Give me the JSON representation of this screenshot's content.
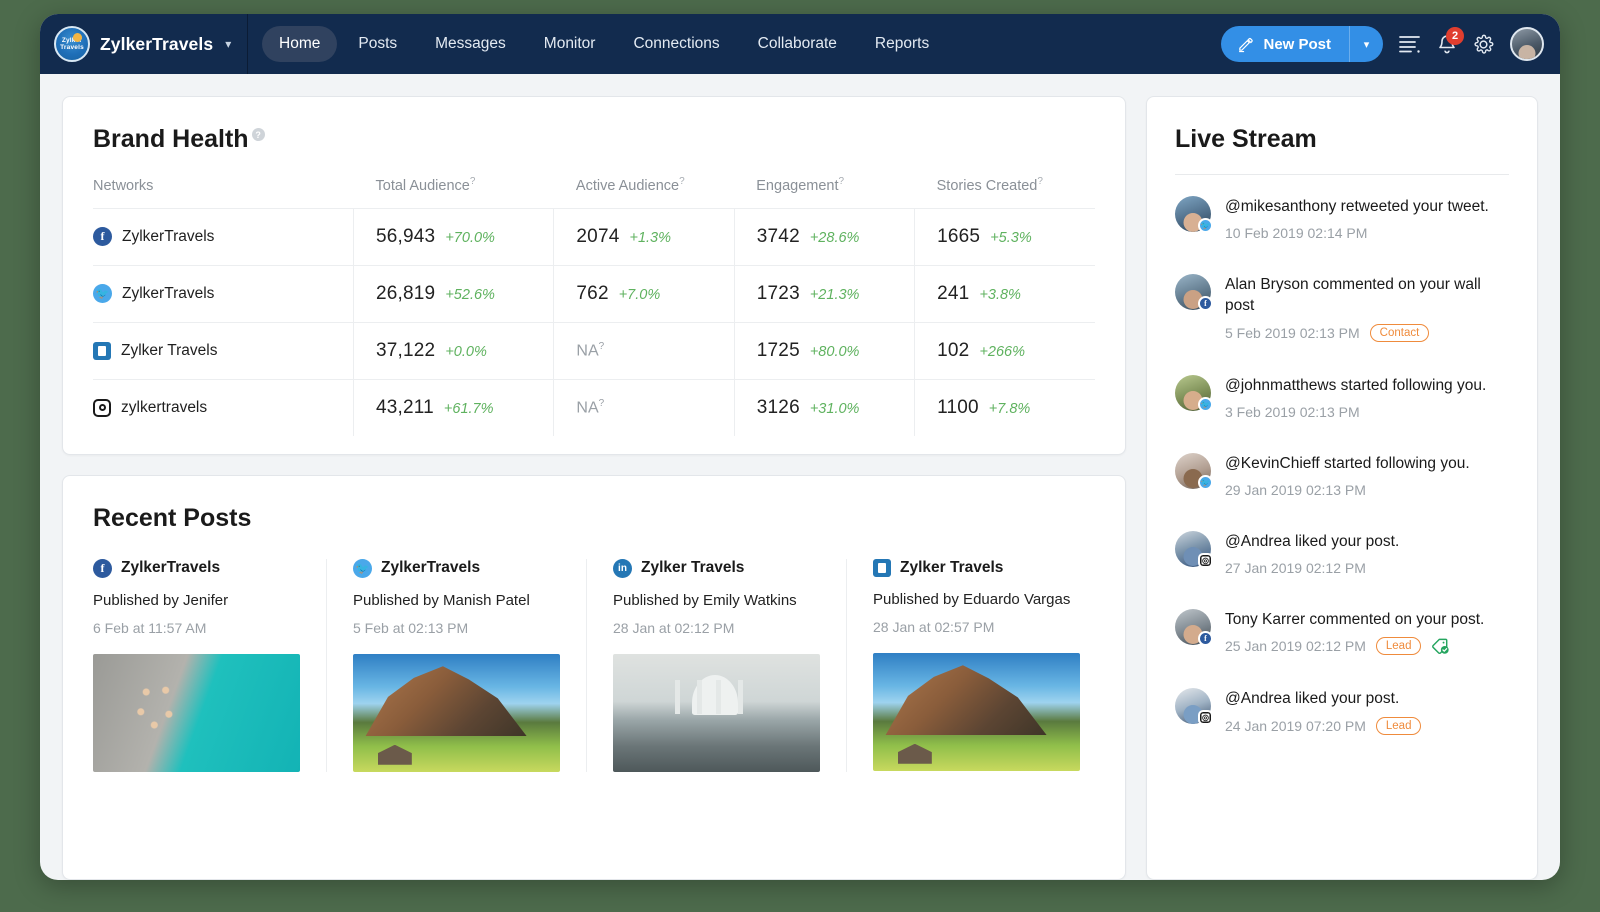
{
  "navbar": {
    "brand_logo_line1": "Zylker",
    "brand_logo_line2": "Travels",
    "brand_name": "ZylkerTravels",
    "brand_caret": "❯",
    "links": [
      {
        "label": "Home",
        "active": true
      },
      {
        "label": "Posts",
        "active": false
      },
      {
        "label": "Messages",
        "active": false
      },
      {
        "label": "Monitor",
        "active": false
      },
      {
        "label": "Connections",
        "active": false
      },
      {
        "label": "Collaborate",
        "active": false
      },
      {
        "label": "Reports",
        "active": false
      }
    ],
    "new_post_label": "New Post",
    "new_post_caret": "❯",
    "notification_count": "2",
    "accent_color": "#338fe6",
    "navbar_color": "#122b4e",
    "badge_color": "#e03e2f"
  },
  "brand_health": {
    "title": "Brand Health",
    "help_glyph": "?",
    "columns": [
      {
        "label": "Networks",
        "has_help": false
      },
      {
        "label": "Total Audience",
        "has_help": true
      },
      {
        "label": "Active Audience",
        "has_help": true
      },
      {
        "label": "Engagement",
        "has_help": true
      },
      {
        "label": "Stories Created",
        "has_help": true
      }
    ],
    "rows": [
      {
        "network": "facebook",
        "icon": "facebook-icon",
        "name": "ZylkerTravels",
        "total_audience": "56,943",
        "total_audience_delta": "+70.0%",
        "active_audience": "2074",
        "active_audience_delta": "+1.3%",
        "engagement": "3742",
        "engagement_delta": "+28.6%",
        "stories_created": "1665",
        "stories_created_delta": "+5.3%"
      },
      {
        "network": "twitter",
        "icon": "twitter-icon",
        "name": "ZylkerTravels",
        "total_audience": "26,819",
        "total_audience_delta": "+52.6%",
        "active_audience": "762",
        "active_audience_delta": "+7.0%",
        "engagement": "1723",
        "engagement_delta": "+21.3%",
        "stories_created": "241",
        "stories_created_delta": "+3.8%"
      },
      {
        "network": "linkedin",
        "icon": "linkedin-company-icon",
        "name": "Zylker Travels",
        "total_audience": "37,122",
        "total_audience_delta": "+0.0%",
        "active_audience": "NA",
        "active_audience_delta": "",
        "engagement": "1725",
        "engagement_delta": "+80.0%",
        "stories_created": "102",
        "stories_created_delta": "+266%"
      },
      {
        "network": "instagram",
        "icon": "instagram-icon",
        "name": "zylkertravels",
        "total_audience": "43,211",
        "total_audience_delta": "+61.7%",
        "active_audience": "NA",
        "active_audience_delta": "",
        "engagement": "3126",
        "engagement_delta": "+31.0%",
        "stories_created": "1100",
        "stories_created_delta": "+7.8%"
      }
    ],
    "na_label": "NA",
    "delta_color": "#5fb25f"
  },
  "recent_posts": {
    "title": "Recent Posts",
    "posts": [
      {
        "network": "facebook",
        "icon": "facebook-icon",
        "account": "ZylkerTravels",
        "published_by": "Published by Jenifer",
        "time": "6 Feb at 11:57 AM",
        "image": "pool-dock-aerial"
      },
      {
        "network": "twitter",
        "icon": "twitter-icon",
        "account": "ZylkerTravels",
        "published_by": "Published by Manish Patel",
        "time": "5 Feb at 02:13 PM",
        "image": "mountain-meadow"
      },
      {
        "network": "linkedin",
        "icon": "linkedin-icon",
        "account": "Zylker Travels",
        "published_by": "Published by Emily Watkins",
        "time": "28 Jan at 02:12 PM",
        "image": "taj-mahal-misty"
      },
      {
        "network": "linkedin-company",
        "icon": "linkedin-company-icon",
        "account": "Zylker Travels",
        "published_by": "Published by Eduardo Vargas",
        "time": "28 Jan at 02:57 PM",
        "image": "mountain-meadow"
      }
    ]
  },
  "live_stream": {
    "title": "Live Stream",
    "items": [
      {
        "message": "@mikesanthony retweeted your tweet.",
        "time": "10 Feb 2019 02:14 PM",
        "network": "twitter",
        "badge": "",
        "has_tag_icon": false,
        "avatar": "av-a"
      },
      {
        "message": "Alan Bryson commented on your wall post",
        "time": "5 Feb 2019 02:13 PM",
        "network": "facebook",
        "badge": "Contact",
        "has_tag_icon": false,
        "avatar": "av-b"
      },
      {
        "message": "@johnmatthews started following you.",
        "time": "3 Feb 2019 02:13 PM",
        "network": "twitter",
        "badge": "",
        "has_tag_icon": false,
        "avatar": "av-c"
      },
      {
        "message": "@KevinChieff started following you.",
        "time": "29 Jan 2019 02:13 PM",
        "network": "twitter",
        "badge": "",
        "has_tag_icon": false,
        "avatar": "av-d"
      },
      {
        "message": "@Andrea liked your post.",
        "time": "27 Jan 2019 02:12 PM",
        "network": "instagram",
        "badge": "",
        "has_tag_icon": false,
        "avatar": "av-e"
      },
      {
        "message": "Tony Karrer commented on your post.",
        "time": "25 Jan 2019 02:12 PM",
        "network": "facebook",
        "badge": "Lead",
        "has_tag_icon": true,
        "avatar": "av-f"
      },
      {
        "message": "@Andrea liked your post.",
        "time": "24 Jan 2019 07:20 PM",
        "network": "instagram",
        "badge": "Lead",
        "has_tag_icon": false,
        "avatar": "av-g"
      }
    ],
    "pill_color": "#ef8b3c"
  }
}
